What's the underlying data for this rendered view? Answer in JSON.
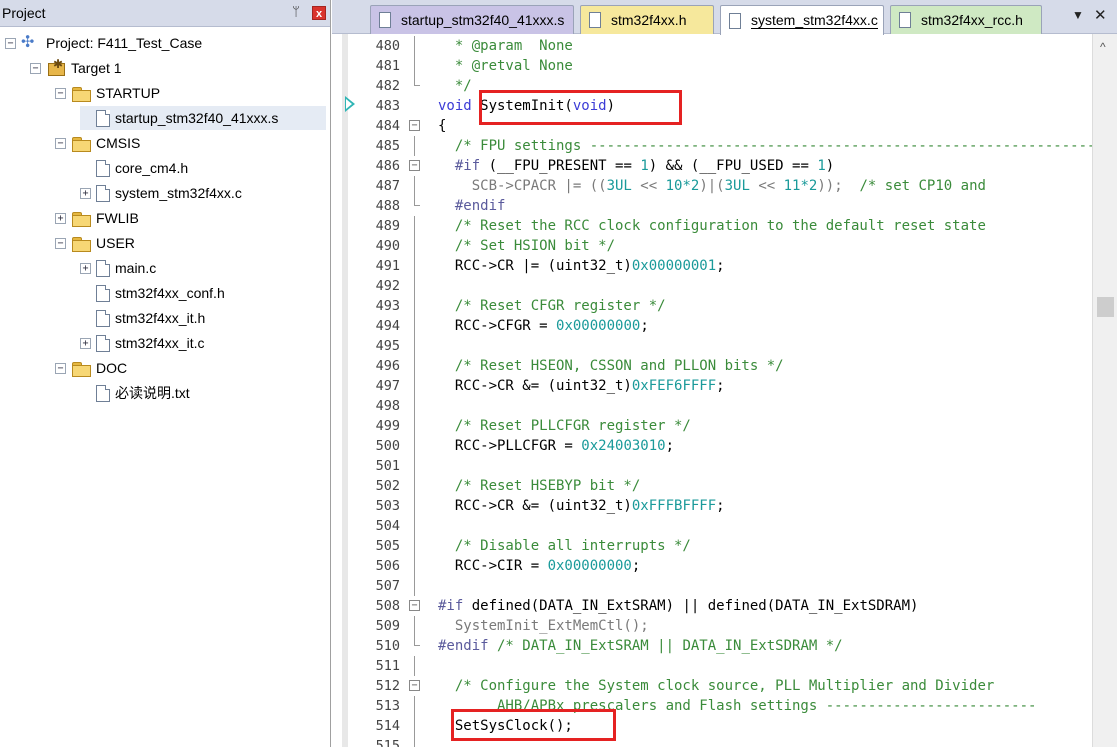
{
  "project_panel": {
    "title": "Project",
    "pin": "ᛘ",
    "close": "x",
    "tree": [
      {
        "id": "project",
        "label": "Project: F411_Test_Case",
        "expander": "−",
        "icon": "project-icon"
      },
      {
        "id": "target",
        "label": "Target 1",
        "expander": "−",
        "icon": "target-icon"
      },
      {
        "id": "startup",
        "label": "STARTUP",
        "expander": "−",
        "icon": "folder-open-icon"
      },
      {
        "id": "startup_s",
        "label": "startup_stm32f40_41xxx.s",
        "icon": "file-icon",
        "selected": true
      },
      {
        "id": "cmsis",
        "label": "CMSIS",
        "expander": "−",
        "icon": "folder-open-icon"
      },
      {
        "id": "core_cm4",
        "label": "core_cm4.h",
        "icon": "file-icon"
      },
      {
        "id": "system_c",
        "label": "system_stm32f4xx.c",
        "expander": "+",
        "icon": "file-icon"
      },
      {
        "id": "fwlib",
        "label": "FWLIB",
        "expander": "+",
        "icon": "folder-icon"
      },
      {
        "id": "user",
        "label": "USER",
        "expander": "−",
        "icon": "folder-open-icon"
      },
      {
        "id": "main_c",
        "label": "main.c",
        "expander": "+",
        "icon": "file-icon"
      },
      {
        "id": "conf_h",
        "label": "stm32f4xx_conf.h",
        "icon": "file-icon"
      },
      {
        "id": "it_h",
        "label": "stm32f4xx_it.h",
        "icon": "file-icon"
      },
      {
        "id": "it_c",
        "label": "stm32f4xx_it.c",
        "expander": "+",
        "icon": "file-icon"
      },
      {
        "id": "doc",
        "label": "DOC",
        "expander": "−",
        "icon": "folder-open-icon"
      },
      {
        "id": "readme",
        "label": "必读说明.txt",
        "icon": "file-icon"
      }
    ]
  },
  "tabs": [
    {
      "label": "startup_stm32f40_41xxx.s",
      "color": "#c9c3e6"
    },
    {
      "label": "stm32f4xx.h",
      "color": "#f6e89c"
    },
    {
      "label": "system_stm32f4xx.c",
      "color": "#ffffff",
      "active": true
    },
    {
      "label": "stm32f4xx_rcc.h",
      "color": "#cfe9c3"
    }
  ],
  "tab_menu": "▼",
  "tab_close": "✕",
  "scroll_up": "^",
  "code": [
    {
      "ln": "480",
      "fold": "line",
      "parts": [
        [
          "comment",
          "  * @param  None"
        ]
      ]
    },
    {
      "ln": "481",
      "fold": "line",
      "parts": [
        [
          "comment",
          "  * @retval None"
        ]
      ]
    },
    {
      "ln": "482",
      "fold": "end",
      "parts": [
        [
          "comment",
          "  */"
        ]
      ]
    },
    {
      "ln": "483",
      "fold": "",
      "parts": [
        [
          "keyword",
          "void"
        ],
        [
          "plain",
          " SystemInit("
        ],
        [
          "keyword",
          "void"
        ],
        [
          "plain",
          ")"
        ]
      ]
    },
    {
      "ln": "484",
      "fold": "box",
      "parts": [
        [
          "plain",
          "{"
        ]
      ]
    },
    {
      "ln": "485",
      "fold": "line",
      "parts": [
        [
          "comment",
          "  /* FPU settings ------------------------------------------------------------"
        ]
      ]
    },
    {
      "ln": "486",
      "fold": "box",
      "parts": [
        [
          "pre",
          "  #if"
        ],
        [
          "plain",
          " (__FPU_PRESENT == "
        ],
        [
          "number",
          "1"
        ],
        [
          "plain",
          ") && (__FPU_USED == "
        ],
        [
          "number",
          "1"
        ],
        [
          "plain",
          ")"
        ]
      ]
    },
    {
      "ln": "487",
      "fold": "line",
      "parts": [
        [
          "dim",
          "    SCB->CPACR |= (("
        ],
        [
          "number",
          "3UL"
        ],
        [
          "dim",
          " << "
        ],
        [
          "number",
          "10*2"
        ],
        [
          "dim",
          ")|("
        ],
        [
          "number",
          "3UL"
        ],
        [
          "dim",
          " << "
        ],
        [
          "number",
          "11*2"
        ],
        [
          "dim",
          "));  "
        ],
        [
          "comment",
          "/* set CP10 and"
        ]
      ]
    },
    {
      "ln": "488",
      "fold": "end",
      "parts": [
        [
          "pre",
          "  #endif"
        ]
      ]
    },
    {
      "ln": "489",
      "fold": "line",
      "parts": [
        [
          "comment",
          "  /* Reset the RCC clock configuration to the default reset state"
        ]
      ]
    },
    {
      "ln": "490",
      "fold": "line",
      "parts": [
        [
          "comment",
          "  /* Set HSION bit */"
        ]
      ]
    },
    {
      "ln": "491",
      "fold": "line",
      "parts": [
        [
          "plain",
          "  RCC->CR |= (uint32_t)"
        ],
        [
          "number",
          "0x00000001"
        ],
        [
          "plain",
          ";"
        ]
      ]
    },
    {
      "ln": "492",
      "fold": "line",
      "parts": [
        [
          "plain",
          ""
        ]
      ]
    },
    {
      "ln": "493",
      "fold": "line",
      "parts": [
        [
          "comment",
          "  /* Reset CFGR register */"
        ]
      ]
    },
    {
      "ln": "494",
      "fold": "line",
      "parts": [
        [
          "plain",
          "  RCC->CFGR = "
        ],
        [
          "number",
          "0x00000000"
        ],
        [
          "plain",
          ";"
        ]
      ]
    },
    {
      "ln": "495",
      "fold": "line",
      "parts": [
        [
          "plain",
          ""
        ]
      ]
    },
    {
      "ln": "496",
      "fold": "line",
      "parts": [
        [
          "comment",
          "  /* Reset HSEON, CSSON and PLLON bits */"
        ]
      ]
    },
    {
      "ln": "497",
      "fold": "line",
      "parts": [
        [
          "plain",
          "  RCC->CR &= (uint32_t)"
        ],
        [
          "number",
          "0xFEF6FFFF"
        ],
        [
          "plain",
          ";"
        ]
      ]
    },
    {
      "ln": "498",
      "fold": "line",
      "parts": [
        [
          "plain",
          ""
        ]
      ]
    },
    {
      "ln": "499",
      "fold": "line",
      "parts": [
        [
          "comment",
          "  /* Reset PLLCFGR register */"
        ]
      ]
    },
    {
      "ln": "500",
      "fold": "line",
      "parts": [
        [
          "plain",
          "  RCC->PLLCFGR = "
        ],
        [
          "number",
          "0x24003010"
        ],
        [
          "plain",
          ";"
        ]
      ]
    },
    {
      "ln": "501",
      "fold": "line",
      "parts": [
        [
          "plain",
          ""
        ]
      ]
    },
    {
      "ln": "502",
      "fold": "line",
      "parts": [
        [
          "comment",
          "  /* Reset HSEBYP bit */"
        ]
      ]
    },
    {
      "ln": "503",
      "fold": "line",
      "parts": [
        [
          "plain",
          "  RCC->CR &= (uint32_t)"
        ],
        [
          "number",
          "0xFFFBFFFF"
        ],
        [
          "plain",
          ";"
        ]
      ]
    },
    {
      "ln": "504",
      "fold": "line",
      "parts": [
        [
          "plain",
          ""
        ]
      ]
    },
    {
      "ln": "505",
      "fold": "line",
      "parts": [
        [
          "comment",
          "  /* Disable all interrupts */"
        ]
      ]
    },
    {
      "ln": "506",
      "fold": "line",
      "parts": [
        [
          "plain",
          "  RCC->CIR = "
        ],
        [
          "number",
          "0x00000000"
        ],
        [
          "plain",
          ";"
        ]
      ]
    },
    {
      "ln": "507",
      "fold": "line",
      "parts": [
        [
          "plain",
          ""
        ]
      ]
    },
    {
      "ln": "508",
      "fold": "box",
      "parts": [
        [
          "pre",
          "#if"
        ],
        [
          "plain",
          " defined(DATA_IN_ExtSRAM) || defined(DATA_IN_ExtSDRAM)"
        ]
      ]
    },
    {
      "ln": "509",
      "fold": "line",
      "parts": [
        [
          "dim",
          "  SystemInit_ExtMemCtl();"
        ]
      ]
    },
    {
      "ln": "510",
      "fold": "end",
      "parts": [
        [
          "pre",
          "#endif"
        ],
        [
          "comment",
          " /* DATA_IN_ExtSRAM || DATA_IN_ExtSDRAM */"
        ]
      ]
    },
    {
      "ln": "511",
      "fold": "line",
      "parts": [
        [
          "plain",
          ""
        ]
      ]
    },
    {
      "ln": "512",
      "fold": "box",
      "parts": [
        [
          "comment",
          "  /* Configure the System clock source, PLL Multiplier and Divider"
        ]
      ]
    },
    {
      "ln": "513",
      "fold": "line",
      "parts": [
        [
          "comment",
          "       AHB/APBx prescalers and Flash settings -------------------------"
        ]
      ]
    },
    {
      "ln": "514",
      "fold": "line",
      "parts": [
        [
          "plain",
          "  SetSysClock();"
        ]
      ]
    },
    {
      "ln": "515",
      "fold": "line",
      "parts": [
        [
          "plain",
          ""
        ]
      ]
    }
  ],
  "colors": {
    "comment": "#3a8b3a",
    "keyword": "#3b3bd6",
    "number": "#1a9a9a",
    "highlight": "#e52222",
    "marker": "#2fb5b5"
  }
}
